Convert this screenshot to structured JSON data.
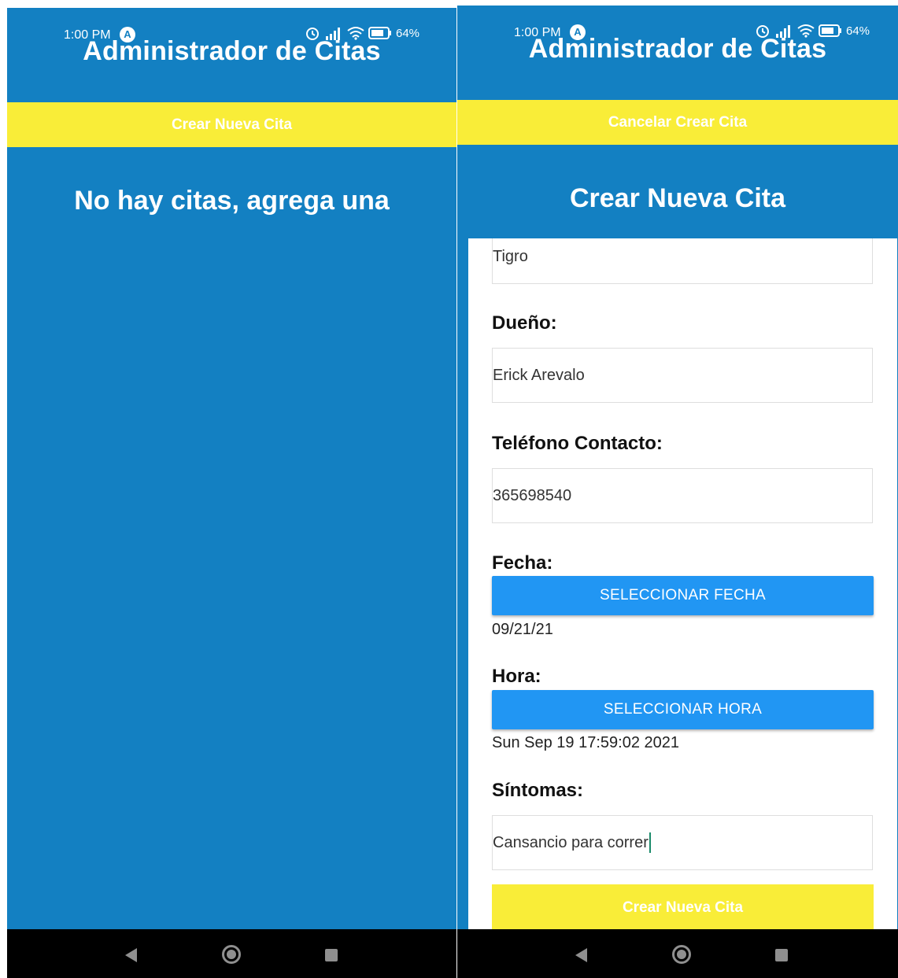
{
  "status_bar": {
    "time": "1:00 PM",
    "app_icon": "A",
    "battery": "64%"
  },
  "app_title": "Administrador de Citas",
  "left_screen": {
    "create_button_label": "Crear Nueva Cita",
    "empty_message": "No hay citas, agrega una"
  },
  "right_screen": {
    "cancel_button_label": "Cancelar Crear Cita",
    "form_title": "Crear Nueva Cita",
    "fields": {
      "pet_value": "Tigro",
      "owner_label": "Dueño:",
      "owner_value": "Erick Arevalo",
      "phone_label": "Teléfono Contacto:",
      "phone_value": "365698540",
      "date_label": "Fecha:",
      "date_button": "SELECCIONAR FECHA",
      "date_value": "09/21/21",
      "time_label": "Hora:",
      "time_button": "SELECCIONAR HORA",
      "time_value": "Sun Sep 19 17:59:02 2021",
      "symptoms_label": "Síntomas:",
      "symptoms_value": "Cansancio para correr"
    },
    "submit_button_label": "Crear Nueva Cita"
  },
  "colors": {
    "app_background": "#1380c2",
    "accent_yellow": "#f9ed38",
    "button_blue": "#2196f3"
  },
  "icons": [
    "alarm-icon",
    "signal-icon",
    "wifi-icon",
    "battery-icon",
    "back-icon",
    "home-icon",
    "recents-icon"
  ]
}
